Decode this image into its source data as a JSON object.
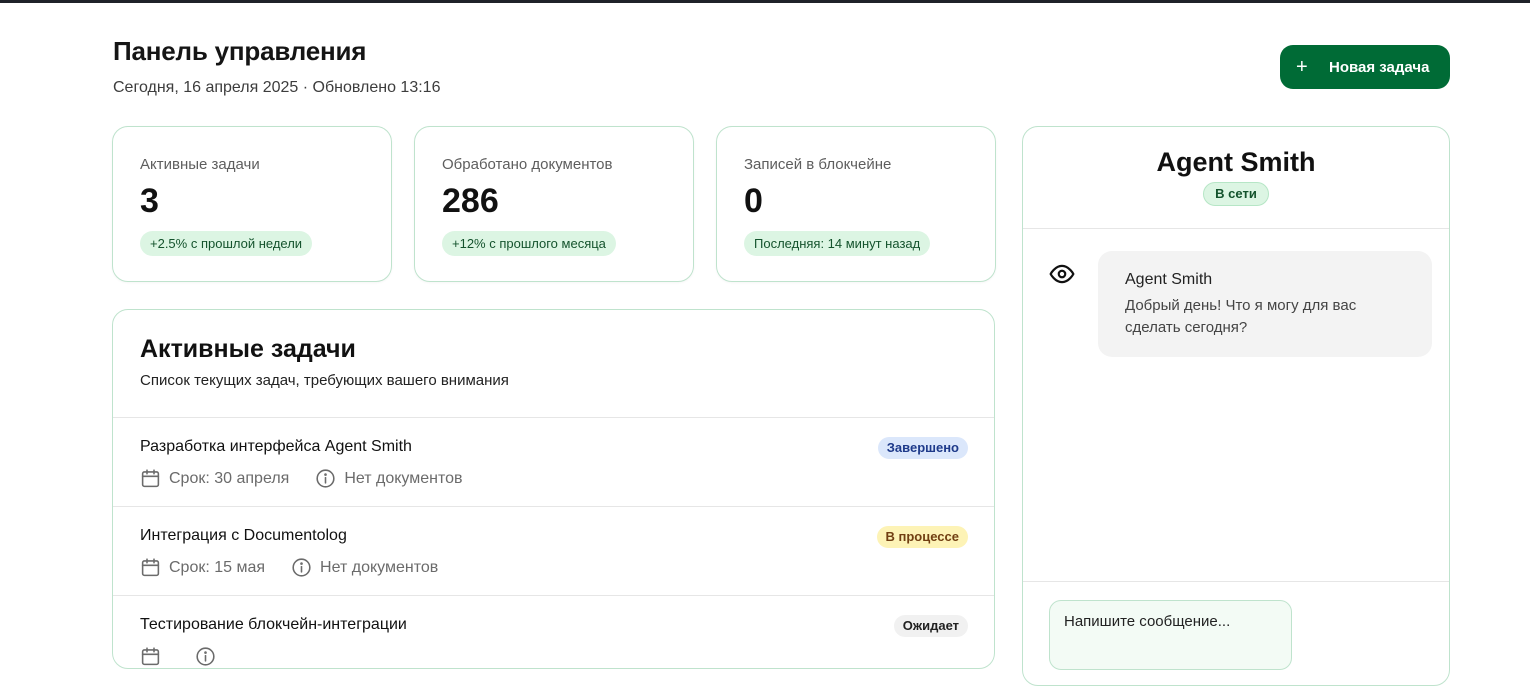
{
  "header": {
    "title": "Панель управления",
    "subtitle": "Сегодня, 16 апреля 2025 · Обновлено 13:16",
    "new_task_icon": "plus-icon",
    "new_task_label": "Новая задача"
  },
  "stats": [
    {
      "label": "Активные задачи",
      "value": "3",
      "badge": "+2.5% с прошлой недели"
    },
    {
      "label": "Обработано документов",
      "value": "286",
      "badge": "+12% с прошлого месяца"
    },
    {
      "label": "Записей в блокчейне",
      "value": "0",
      "badge": "Последняя: 14 минут назад"
    }
  ],
  "tasks": {
    "title": "Активные задачи",
    "description": "Список текущих задач, требующих вашего внимания",
    "items": [
      {
        "name": "Разработка интерфейса Agent Smith",
        "due": "Срок: 30 апреля",
        "docs": "Нет документов",
        "status": "Завершено"
      },
      {
        "name": "Интеграция с Documentolog",
        "due": "Срок: 15 мая",
        "docs": "Нет документов",
        "status": "В процессе"
      },
      {
        "name": "Тестирование блокчейн-интеграции",
        "due": "",
        "docs": "",
        "status": "Ожидает"
      }
    ]
  },
  "chat": {
    "agent_name": "Agent Smith",
    "status": "В сети",
    "message": {
      "icon": "eye-icon",
      "sender": "Agent Smith",
      "text": "Добрый день! Что я могу для вас сделать сегодня?"
    },
    "input_placeholder": "Напишите сообщение..."
  },
  "colors": {
    "accent": "#006b36",
    "card_border": "#bfe3cd",
    "badge_green_bg": "#dcf5e3",
    "status_done_bg": "#dbe7fb",
    "status_progress_bg": "#fdf3b6",
    "status_wait_bg": "#f1f1f1"
  }
}
